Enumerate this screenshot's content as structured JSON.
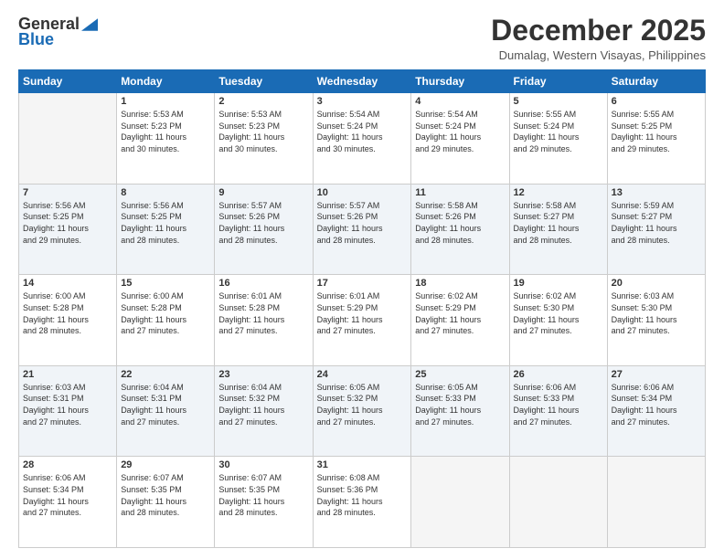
{
  "header": {
    "logo_general": "General",
    "logo_blue": "Blue",
    "month": "December 2025",
    "location": "Dumalag, Western Visayas, Philippines"
  },
  "weekdays": [
    "Sunday",
    "Monday",
    "Tuesday",
    "Wednesday",
    "Thursday",
    "Friday",
    "Saturday"
  ],
  "weeks": [
    [
      {
        "day": "",
        "info": ""
      },
      {
        "day": "1",
        "info": "Sunrise: 5:53 AM\nSunset: 5:23 PM\nDaylight: 11 hours\nand 30 minutes."
      },
      {
        "day": "2",
        "info": "Sunrise: 5:53 AM\nSunset: 5:23 PM\nDaylight: 11 hours\nand 30 minutes."
      },
      {
        "day": "3",
        "info": "Sunrise: 5:54 AM\nSunset: 5:24 PM\nDaylight: 11 hours\nand 30 minutes."
      },
      {
        "day": "4",
        "info": "Sunrise: 5:54 AM\nSunset: 5:24 PM\nDaylight: 11 hours\nand 29 minutes."
      },
      {
        "day": "5",
        "info": "Sunrise: 5:55 AM\nSunset: 5:24 PM\nDaylight: 11 hours\nand 29 minutes."
      },
      {
        "day": "6",
        "info": "Sunrise: 5:55 AM\nSunset: 5:25 PM\nDaylight: 11 hours\nand 29 minutes."
      }
    ],
    [
      {
        "day": "7",
        "info": "Sunrise: 5:56 AM\nSunset: 5:25 PM\nDaylight: 11 hours\nand 29 minutes."
      },
      {
        "day": "8",
        "info": "Sunrise: 5:56 AM\nSunset: 5:25 PM\nDaylight: 11 hours\nand 28 minutes."
      },
      {
        "day": "9",
        "info": "Sunrise: 5:57 AM\nSunset: 5:26 PM\nDaylight: 11 hours\nand 28 minutes."
      },
      {
        "day": "10",
        "info": "Sunrise: 5:57 AM\nSunset: 5:26 PM\nDaylight: 11 hours\nand 28 minutes."
      },
      {
        "day": "11",
        "info": "Sunrise: 5:58 AM\nSunset: 5:26 PM\nDaylight: 11 hours\nand 28 minutes."
      },
      {
        "day": "12",
        "info": "Sunrise: 5:58 AM\nSunset: 5:27 PM\nDaylight: 11 hours\nand 28 minutes."
      },
      {
        "day": "13",
        "info": "Sunrise: 5:59 AM\nSunset: 5:27 PM\nDaylight: 11 hours\nand 28 minutes."
      }
    ],
    [
      {
        "day": "14",
        "info": "Sunrise: 6:00 AM\nSunset: 5:28 PM\nDaylight: 11 hours\nand 28 minutes."
      },
      {
        "day": "15",
        "info": "Sunrise: 6:00 AM\nSunset: 5:28 PM\nDaylight: 11 hours\nand 27 minutes."
      },
      {
        "day": "16",
        "info": "Sunrise: 6:01 AM\nSunset: 5:28 PM\nDaylight: 11 hours\nand 27 minutes."
      },
      {
        "day": "17",
        "info": "Sunrise: 6:01 AM\nSunset: 5:29 PM\nDaylight: 11 hours\nand 27 minutes."
      },
      {
        "day": "18",
        "info": "Sunrise: 6:02 AM\nSunset: 5:29 PM\nDaylight: 11 hours\nand 27 minutes."
      },
      {
        "day": "19",
        "info": "Sunrise: 6:02 AM\nSunset: 5:30 PM\nDaylight: 11 hours\nand 27 minutes."
      },
      {
        "day": "20",
        "info": "Sunrise: 6:03 AM\nSunset: 5:30 PM\nDaylight: 11 hours\nand 27 minutes."
      }
    ],
    [
      {
        "day": "21",
        "info": "Sunrise: 6:03 AM\nSunset: 5:31 PM\nDaylight: 11 hours\nand 27 minutes."
      },
      {
        "day": "22",
        "info": "Sunrise: 6:04 AM\nSunset: 5:31 PM\nDaylight: 11 hours\nand 27 minutes."
      },
      {
        "day": "23",
        "info": "Sunrise: 6:04 AM\nSunset: 5:32 PM\nDaylight: 11 hours\nand 27 minutes."
      },
      {
        "day": "24",
        "info": "Sunrise: 6:05 AM\nSunset: 5:32 PM\nDaylight: 11 hours\nand 27 minutes."
      },
      {
        "day": "25",
        "info": "Sunrise: 6:05 AM\nSunset: 5:33 PM\nDaylight: 11 hours\nand 27 minutes."
      },
      {
        "day": "26",
        "info": "Sunrise: 6:06 AM\nSunset: 5:33 PM\nDaylight: 11 hours\nand 27 minutes."
      },
      {
        "day": "27",
        "info": "Sunrise: 6:06 AM\nSunset: 5:34 PM\nDaylight: 11 hours\nand 27 minutes."
      }
    ],
    [
      {
        "day": "28",
        "info": "Sunrise: 6:06 AM\nSunset: 5:34 PM\nDaylight: 11 hours\nand 27 minutes."
      },
      {
        "day": "29",
        "info": "Sunrise: 6:07 AM\nSunset: 5:35 PM\nDaylight: 11 hours\nand 28 minutes."
      },
      {
        "day": "30",
        "info": "Sunrise: 6:07 AM\nSunset: 5:35 PM\nDaylight: 11 hours\nand 28 minutes."
      },
      {
        "day": "31",
        "info": "Sunrise: 6:08 AM\nSunset: 5:36 PM\nDaylight: 11 hours\nand 28 minutes."
      },
      {
        "day": "",
        "info": ""
      },
      {
        "day": "",
        "info": ""
      },
      {
        "day": "",
        "info": ""
      }
    ]
  ]
}
